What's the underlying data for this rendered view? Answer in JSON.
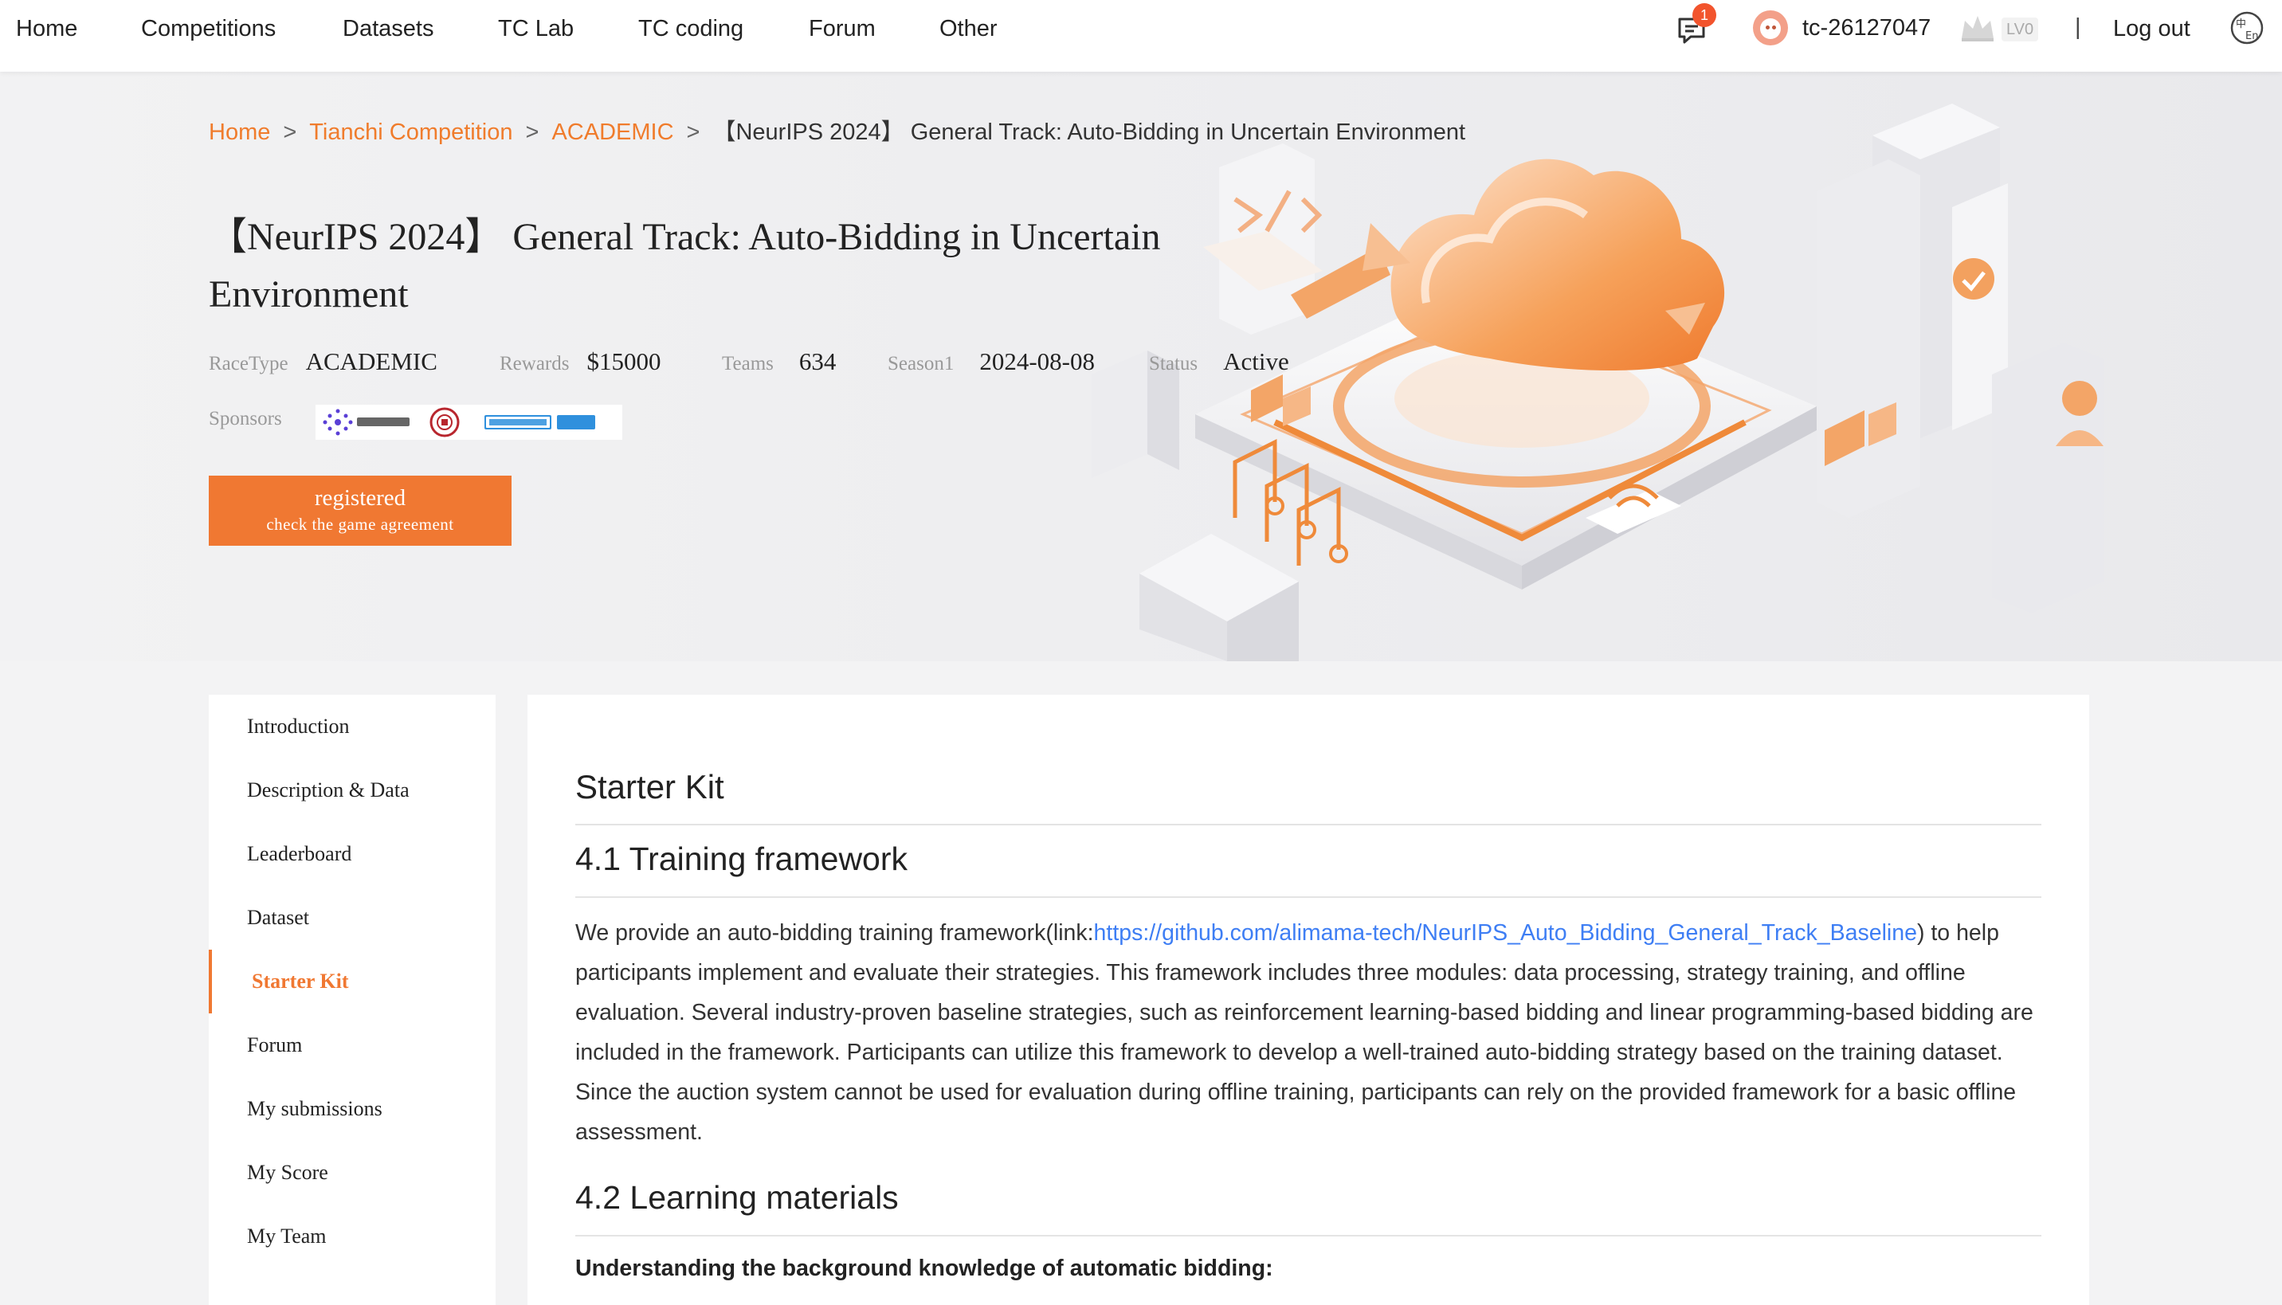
{
  "nav": {
    "items": [
      "Home",
      "Competitions",
      "Datasets",
      "TC Lab",
      "TC coding",
      "Forum",
      "Other"
    ],
    "message_count": "1",
    "username": "tc-26127047",
    "level": "LV0",
    "separator": "|",
    "logout": "Log out"
  },
  "breadcrumb": {
    "home": "Home",
    "competition": "Tianchi Competition",
    "category": "ACADEMIC",
    "current": "【NeurIPS 2024】 General Track: Auto-Bidding in Uncertain Environment",
    "separator": ">"
  },
  "competition": {
    "title": "【NeurIPS 2024】 General Track: Auto-Bidding in Uncertain Environment",
    "meta": [
      {
        "label": "RaceType",
        "value": "ACADEMIC"
      },
      {
        "label": "Rewards",
        "value": "$15000"
      },
      {
        "label": "Teams",
        "value": "634"
      },
      {
        "label": "Season1",
        "value": "2024-08-08"
      },
      {
        "label": "Status",
        "value": "Active"
      }
    ],
    "sponsors_label": "Sponsors",
    "sponsor_logos": [
      "alimama-logo",
      "university-seal-logo",
      "tianchi-logo"
    ],
    "register_button": {
      "label": "registered",
      "sublabel": "check the game agreement"
    }
  },
  "sidebar": {
    "items": [
      {
        "label": "Introduction"
      },
      {
        "label": "Description & Data"
      },
      {
        "label": "Leaderboard"
      },
      {
        "label": "Dataset"
      },
      {
        "label": "Starter Kit",
        "active": true
      },
      {
        "label": "Forum"
      },
      {
        "label": "My submissions"
      },
      {
        "label": "My Score"
      },
      {
        "label": "My Team"
      }
    ]
  },
  "content": {
    "heading": "Starter Kit",
    "section1_title": "4.1 Training framework",
    "section1_text_before": "We provide an auto-bidding training framework(link:",
    "section1_link": "https://github.com/alimama-tech/NeurIPS_Auto_Bidding_General_Track_Baseline",
    "section1_text_after": ") to help participants implement and evaluate their strategies. This framework includes three modules: data processing, strategy training, and offline evaluation. Several industry-proven baseline strategies, such as reinforcement learning-based bidding and linear programming-based bidding are included in the framework. Participants can utilize this framework to develop a well-trained auto-bidding strategy based on the training dataset. Since the auction system cannot be used for evaluation during offline training, participants can rely on the provided framework for a basic offline assessment.",
    "section2_title": "4.2 Learning materials",
    "section2_subtitle": "Understanding the background knowledge of automatic bidding:"
  },
  "colors": {
    "accent": "#f07832",
    "link": "#3e7ef4",
    "badge": "#f2542d"
  },
  "icons": [
    "message-icon",
    "avatar-icon",
    "crown-icon",
    "language-switch-icon"
  ]
}
